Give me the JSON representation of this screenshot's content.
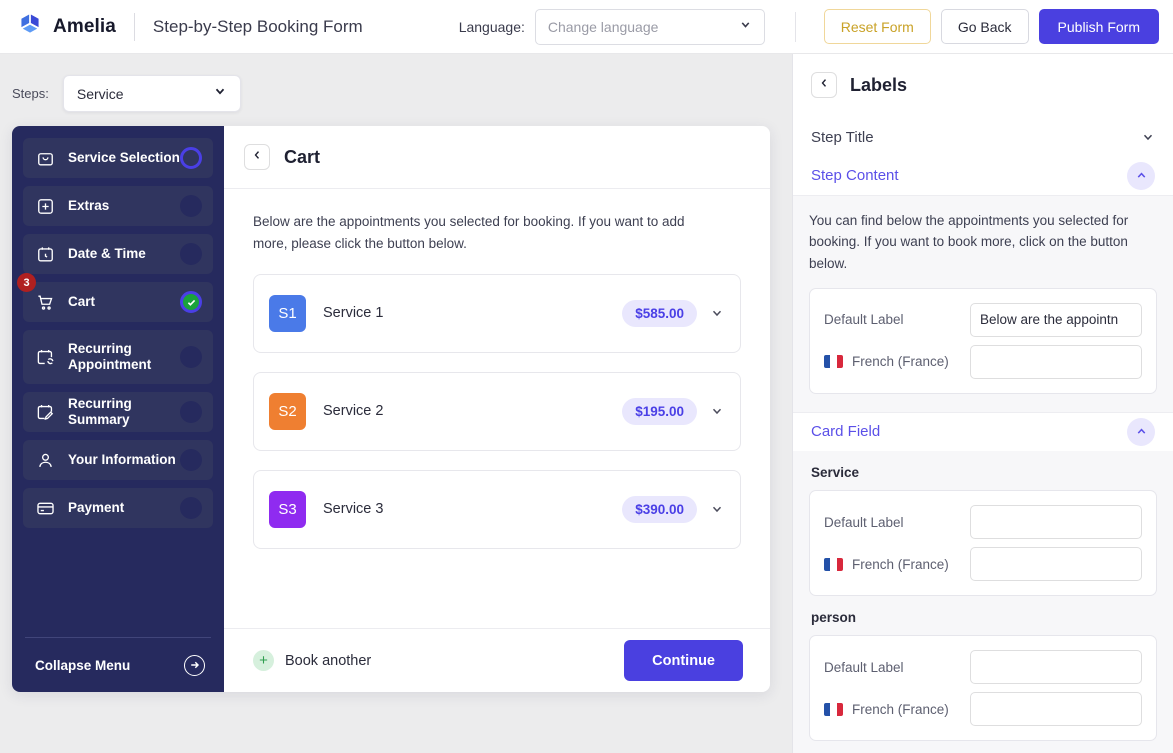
{
  "topbar": {
    "brand": "Amelia",
    "brand_logo_icon": "amelia-cube-logo",
    "form_title": "Step-by-Step Booking Form",
    "language_label": "Language:",
    "language_placeholder": "Change language",
    "language_value": "",
    "reset_label": "Reset Form",
    "goback_label": "Go Back",
    "publish_label": "Publish Form"
  },
  "canvas": {
    "steps_label": "Steps:",
    "steps_value": "Service"
  },
  "stepbar": {
    "items": [
      {
        "label": "Service Selection",
        "icon": "service-bag-icon",
        "state": "active"
      },
      {
        "label": "Extras",
        "icon": "plus-square-icon",
        "state": "idle"
      },
      {
        "label": "Date & Time",
        "icon": "calendar-clock-icon",
        "state": "idle"
      },
      {
        "label": "Cart",
        "icon": "cart-icon",
        "state": "done",
        "badge": "3"
      },
      {
        "label": "Recurring Appointment",
        "icon": "calendar-repeat-icon",
        "state": "idle"
      },
      {
        "label": "Recurring Summary",
        "icon": "calendar-edit-icon",
        "state": "idle"
      },
      {
        "label": "Your Information",
        "icon": "user-icon",
        "state": "idle"
      },
      {
        "label": "Payment",
        "icon": "credit-card-icon",
        "state": "idle"
      }
    ],
    "collapse_label": "Collapse Menu",
    "collapse_icon": "arrow-right-circle-icon"
  },
  "panel": {
    "back_icon": "chevron-left-icon",
    "title": "Cart",
    "intro": "Below are the appointments you selected for booking. If you want to add more, please click the button below.",
    "services": [
      {
        "code": "S1",
        "name": "Service 1",
        "price": "$585.00",
        "color": "#4a7ae8"
      },
      {
        "code": "S2",
        "name": "Service 2",
        "price": "$195.00",
        "color": "#ef7f31"
      },
      {
        "code": "S3",
        "name": "Service 3",
        "price": "$390.00",
        "color": "#8f2bf0"
      }
    ],
    "book_another_label": "Book another",
    "book_another_icon": "plus-icon",
    "continue_label": "Continue"
  },
  "rightpanel": {
    "back_icon": "chevron-left-icon",
    "title": "Labels",
    "sections": [
      {
        "title": "Step Title",
        "open": false,
        "chevron_icon": "chevron-down-icon"
      },
      {
        "title": "Step Content",
        "open": true,
        "chevron_icon": "chevron-up-icon",
        "description": "You can find below the appointments you selected for booking. If you want to book more, click on the button below.",
        "fields": [
          {
            "label": "Default Label",
            "value": "Below are the appointn",
            "flag": null
          },
          {
            "label": "French (France)",
            "value": "",
            "flag": "fr"
          }
        ]
      },
      {
        "title": "Card Field",
        "open": true,
        "chevron_icon": "chevron-up-icon",
        "groups": [
          {
            "name": "Service",
            "fields": [
              {
                "label": "Default Label",
                "value": "",
                "flag": null
              },
              {
                "label": "French (France)",
                "value": "",
                "flag": "fr"
              }
            ]
          },
          {
            "name": "person",
            "fields": [
              {
                "label": "Default Label",
                "value": "",
                "flag": null
              },
              {
                "label": "French (France)",
                "value": "",
                "flag": "fr"
              }
            ]
          }
        ]
      }
    ]
  },
  "colors": {
    "accent": "#4a40e0",
    "sidebar_bg": "#262a5e",
    "step_bg": "#30355f",
    "badge_red": "#b02020",
    "done_green": "#1aa33b",
    "warn_yellow": "#c9a227"
  }
}
